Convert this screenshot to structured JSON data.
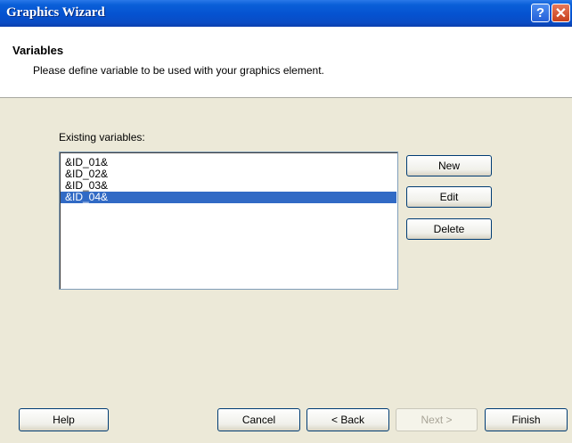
{
  "window": {
    "title": "Graphics Wizard",
    "help_glyph": "?",
    "close_glyph": "✕"
  },
  "header": {
    "title": "Variables",
    "description": "Please define variable to be used with your graphics element."
  },
  "variables": {
    "label": "Existing variables:",
    "items": [
      "&ID_01&",
      "&ID_02&",
      "&ID_03&",
      "&ID_04&"
    ],
    "selected_index": 3
  },
  "side_buttons": {
    "new": "New",
    "edit": "Edit",
    "delete": "Delete"
  },
  "footer": {
    "help": "Help",
    "cancel": "Cancel",
    "back": "< Back",
    "next": "Next >",
    "finish": "Finish"
  },
  "colors": {
    "titlebar": "#0552d0",
    "selection": "#316ac5",
    "dialog_bg": "#ece9d8"
  }
}
